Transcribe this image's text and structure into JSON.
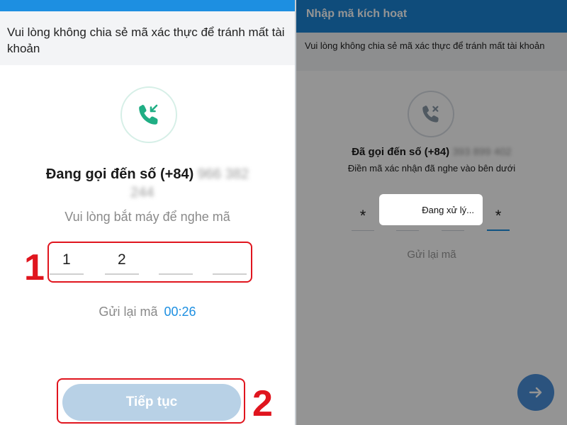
{
  "left": {
    "warning": "Vui lòng không chia sẻ mã xác thực để tránh mất tài khoản",
    "calling_prefix": "Đang gọi đến số (+84)",
    "calling_number_part1": "966 382",
    "calling_number_part2": "244",
    "pickup_text": "Vui lòng bắt máy để nghe mã",
    "otp_digits": [
      "1",
      "2",
      "",
      ""
    ],
    "resend_label": "Gửi lại mã",
    "resend_timer": "00:26",
    "continue_label": "Tiếp tục",
    "annotation_1": "1",
    "annotation_2": "2"
  },
  "right": {
    "header_title": "Nhập mã kích hoạt",
    "warning": "Vui lòng không chia sẻ mã xác thực để tránh mất tài khoản",
    "called_prefix": "Đã gọi đến số (+84)",
    "called_number": "393 899 402",
    "enter_hint": "Điền mã xác nhận đã nghe vào bên dưới",
    "otp_digits": [
      "*",
      "",
      "",
      "*"
    ],
    "processing_text": "Đang xử lý...",
    "resend_label": "Gửi lại mã"
  },
  "colors": {
    "accent_blue": "#1d8fe1",
    "annotation_red": "#e0151e",
    "call_green": "#1fae84"
  },
  "icons": {
    "incoming_call": "phone-incoming-icon",
    "missed_call": "phone-missed-icon",
    "next_arrow": "arrow-right-icon"
  }
}
